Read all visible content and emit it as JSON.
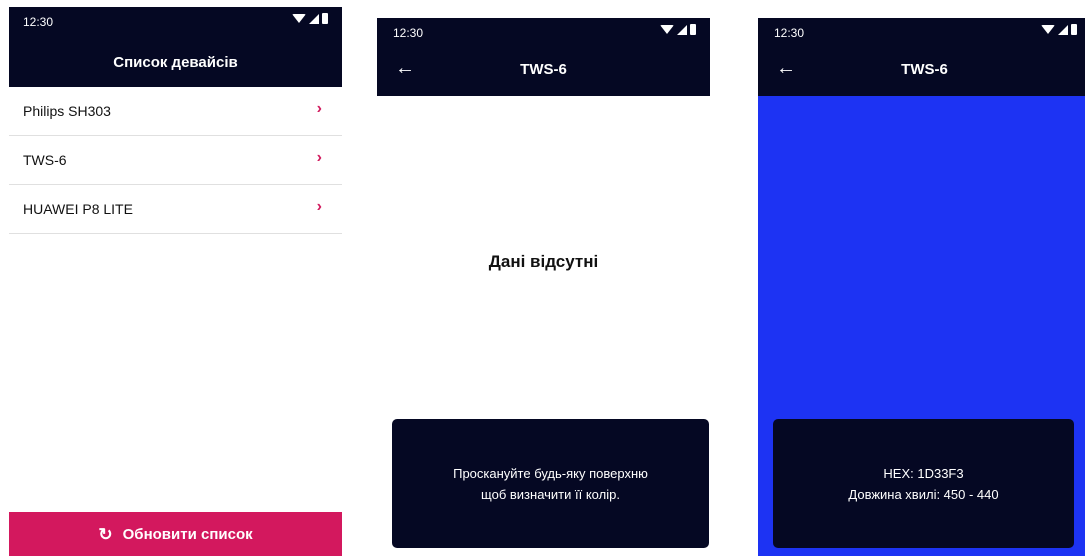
{
  "colors": {
    "appbar_bg": "#050823",
    "accent": "#d3185e",
    "scanned_color": "#1d33f3"
  },
  "status_bar": {
    "time": "12:30",
    "icons": [
      "wifi-icon",
      "signal-icon",
      "battery-icon"
    ]
  },
  "device_list_screen": {
    "title": "Список девайсів",
    "devices": [
      {
        "label": "Philips SH303",
        "icon": "chevron-right-icon",
        "chevron": "›"
      },
      {
        "label": "TWS-6",
        "icon": "chevron-right-icon",
        "chevron": "›"
      },
      {
        "label": "HUAWEI P8 LITE",
        "icon": "chevron-right-icon",
        "chevron": "›"
      }
    ],
    "refresh_button": {
      "label": "Обновити список",
      "icon": "refresh-icon",
      "glyph": "↻"
    }
  },
  "empty_screen": {
    "title": "TWS-6",
    "back_icon": "←",
    "empty_message": "Дані відсутні",
    "hint_line1": "Проскануйте будь-яку поверхню",
    "hint_line2": "щоб визначити її колір."
  },
  "color_screen": {
    "title": "TWS-6",
    "back_icon": "←",
    "hex_label": "HEX: 1D33F3",
    "wavelength_label": "Довжина хвилі: 450 - 440"
  }
}
